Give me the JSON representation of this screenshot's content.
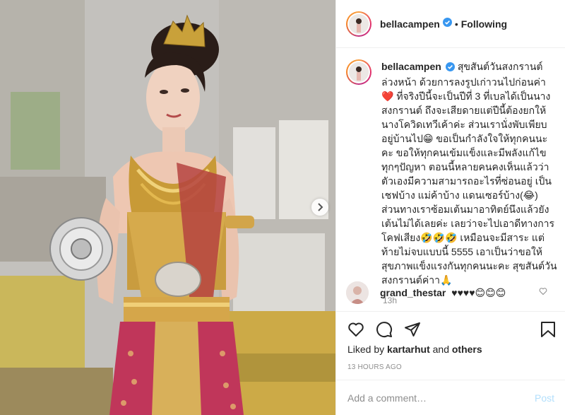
{
  "post": {
    "author": "bellacampen",
    "follow_state": "Following",
    "separator": "•",
    "caption": "สุขสันต์วันสงกรานต์ล่วงหน้า ด้วยการลงรูปเก่าวนไปก่อนค่า❤️ ที่จริงปีนี้จะเป็นปีที่ 3 ที่เบลได้เป็นนางสงกรานต์ ถึงจะเสียดายแต่ปีนี้ต้องยกให้นางโควิดเทวีเค้าค่ะ ส่วนเรานั่งพับเพียบอยู่บ้านไป😁 ขอเป็นกำลังใจให้ทุกคนนะคะ ขอให้ทุกคนเข้มแข็งและมีพลังแก้ไขทุกๆปัญหา ตอนนี้หลายคนคงเห็นแล้วว่าตัวเองมีความสามารถอะไรที่ซ่อนอยู่ เป็นเชฟบ้าง แม่ค้าบ้าง แดนเซอร์บ้าง(😂) ส่วนทางเราซ้อมเต้นมาอาทิตย์นึงแล้วยังเต้นไม่ได้เลยค่ะ เลยว่าจะไปเอาดีทางการโคฟเสียง🤣🤣🤣 เหมือนจะมีสาระ แต่ท้ายไม่จบแบบนี้ 5555 เอาเป็นว่าขอให้สุขภาพแข็งแรงกันทุกคนนะคะ สุขสันต์วันสงกรานต์ค่าา🙏",
    "caption_age": "13h",
    "comment": {
      "user": "grand_thestar",
      "text": "♥♥♥♥😊😊😊"
    },
    "likes": {
      "prefix": "Liked by",
      "user": "kartarhut",
      "and_text": "and",
      "others": "others"
    },
    "timestamp": "13 HOURS AGO",
    "add_comment_placeholder": "Add a comment…",
    "post_label": "Post"
  },
  "icons": {
    "verified": "verified-badge-icon",
    "like": "heart-icon",
    "comment": "comment-bubble-icon",
    "share": "paper-plane-icon",
    "save": "bookmark-icon",
    "next": "chevron-right-icon",
    "comment_like": "small-heart-icon"
  },
  "colors": {
    "verified": "#3897f0",
    "post_button": "#b2dffc",
    "muted": "#8e8e8e",
    "text": "#262626"
  }
}
